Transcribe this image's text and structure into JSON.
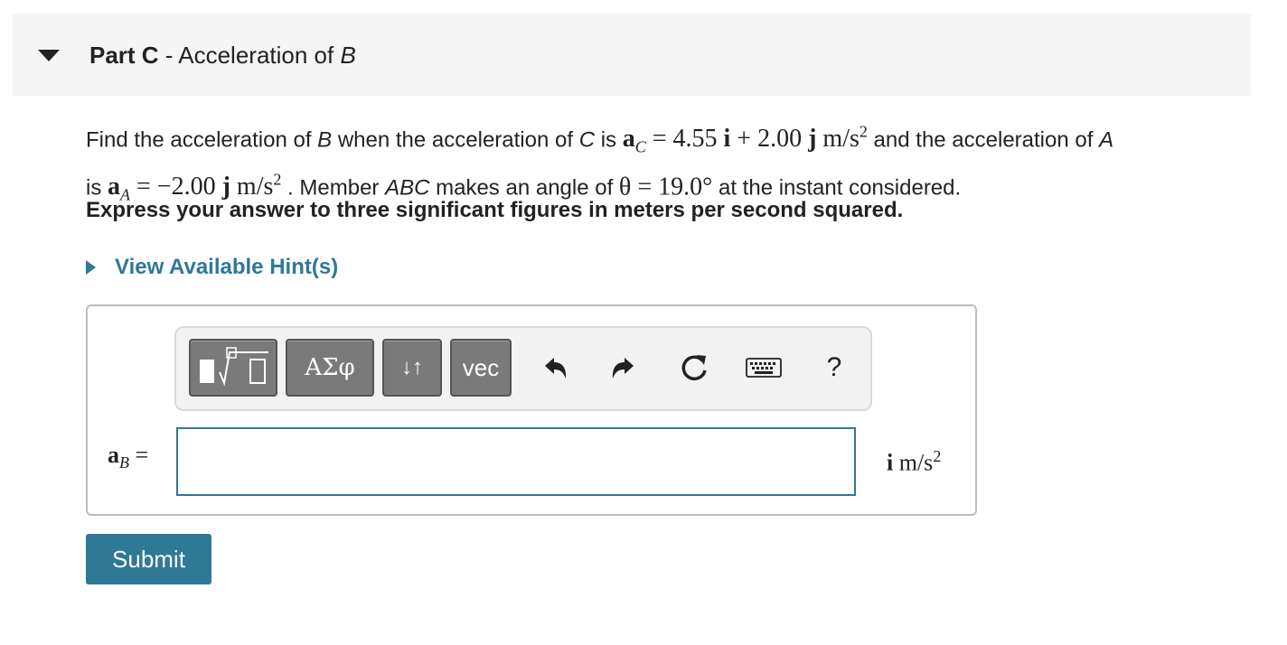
{
  "part": {
    "prefix": "Part C",
    "separator": " - ",
    "title": "Acceleration of ",
    "title_var": "B"
  },
  "problem": {
    "t1": "Find the acceleration of ",
    "v1": "B",
    "t2": " when the acceleration of ",
    "v2": "C",
    "t3": " is ",
    "aC_symbol": "a",
    "aC_sub": "C",
    "aC_expr": " = 4.55 ",
    "aC_i": "i",
    "aC_plus": " + 2.00 ",
    "aC_j": "j",
    "aC_unit": " m/s",
    "aC_exp": "2",
    "t4": " and the acceleration of ",
    "v3": "A",
    "t5": "is ",
    "aA_symbol": "a",
    "aA_sub": "A",
    "aA_expr": " = −2.00 ",
    "aA_j": "j",
    "aA_unit": " m/s",
    "aA_exp": "2",
    "t6": " . Member ",
    "v4": "ABC",
    "t7": " makes an angle of ",
    "theta": "θ = 19.0°",
    "t8": " at the instant considered."
  },
  "instruction": "Express your answer to three significant figures in meters per second squared.",
  "hint": {
    "label": "View Available Hint(s)"
  },
  "toolbar": {
    "greek_label": "ΑΣφ",
    "arrows_label": "↓↑",
    "vec_label": "vec",
    "help_label": "?"
  },
  "answer": {
    "var_symbol": "a",
    "var_sub": "B",
    "equals": " =",
    "value": "",
    "unit_i": "i",
    "unit_text": " m/s",
    "unit_exp": "2"
  },
  "submit_label": "Submit",
  "colors": {
    "accent": "#2f7896",
    "toolbar_button": "#7a7a7a",
    "header_bg": "#f5f5f5"
  }
}
